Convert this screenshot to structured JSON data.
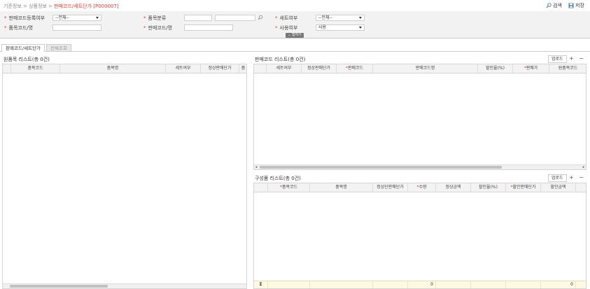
{
  "breadcrumb": {
    "path": "기준정보 > 상품정보 > ",
    "current": "판매코드/세트단가 [P000007]"
  },
  "toolbar": {
    "search_label": "검색",
    "save_label": "저장"
  },
  "filters": {
    "sale_code_reg": {
      "label": "판매코드등록여부",
      "value": "--전체--"
    },
    "item_code": {
      "label": "품목코드/명",
      "value": ""
    },
    "item_class": {
      "label": "품목분류",
      "value": ""
    },
    "sale_code": {
      "label": "판매코드/명",
      "value": ""
    },
    "set_yn": {
      "label": "세트여부",
      "value": "--전체--"
    },
    "use_yn": {
      "label": "사용여부",
      "value": "사용"
    },
    "collapse_label": "접히기"
  },
  "tabs": [
    {
      "label": "판매코드/세트단가"
    },
    {
      "label": "전체조회"
    }
  ],
  "left_panel": {
    "title": "원품목 리스트(총 0건)",
    "columns": [
      "품목코드",
      "품목명",
      "세트여부",
      "정상판매단가",
      "품"
    ]
  },
  "sale_panel": {
    "title": "판매코드 리스트(총 0건)",
    "upload_label": "업로드",
    "columns": [
      {
        "label": "세트여부",
        "req": ""
      },
      {
        "label": "정상판매단가",
        "req": ""
      },
      {
        "label": "판매코드",
        "req": "*"
      },
      {
        "label": "판매코드명",
        "req": ""
      },
      {
        "label": "할인율(%)",
        "req": ""
      },
      {
        "label": "판매가",
        "req": "*"
      },
      {
        "label": "원품목코드",
        "req": ""
      }
    ]
  },
  "component_panel": {
    "title": "구성품 리스트(총 0건)",
    "upload_label": "업로드",
    "columns": [
      {
        "label": "품목코드",
        "req": "*"
      },
      {
        "label": "품목명",
        "req": ""
      },
      {
        "label": "정상단판매단가",
        "req": ""
      },
      {
        "label": "수량",
        "req": "*"
      },
      {
        "label": "정상금액",
        "req": ""
      },
      {
        "label": "할인율(%)",
        "req": ""
      },
      {
        "label": "할인판매단가",
        "req": "*"
      },
      {
        "label": "할인금액",
        "req": ""
      }
    ],
    "footer": {
      "sigma": "Σ",
      "qty_total": "0",
      "amount_total": "0"
    }
  },
  "colors": {
    "accent": "#e53935",
    "panel_bg": "#f2f2f2",
    "footer_bg": "#fdf9e3"
  }
}
